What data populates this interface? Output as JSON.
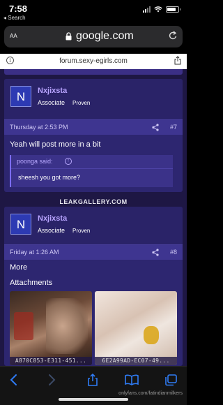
{
  "status_bar": {
    "time": "7:58",
    "back_label": "◂ Search"
  },
  "browser": {
    "text_size_label": "AA",
    "host": "google.com",
    "site_url": "forum.sexy-egirls.com",
    "info_symbol": "i"
  },
  "posts": [
    {
      "avatar_letter": "N",
      "username": "Nxjixsta",
      "user_title": "Associate",
      "user_badge": "Proven",
      "date": "Thursday at 2:53 PM",
      "number": "#7",
      "text": "Yeah will post more in a bit",
      "quote": {
        "author": "poonga said:",
        "arrow": "↑",
        "text": "sheesh you got more?"
      }
    },
    {
      "avatar_letter": "N",
      "username": "Nxjixsta",
      "user_title": "Associate",
      "user_badge": "Proven",
      "date": "Friday at 1:26 AM",
      "number": "#8",
      "text": "More",
      "attachments_label": "Attachments",
      "attachments": [
        {
          "caption": "A870C853-E311-451..."
        },
        {
          "caption": "6E2A99AD-EC07-49..."
        }
      ]
    }
  ],
  "watermarks": {
    "center": "LEAKGALLERY.COM",
    "corner": "onlyfans.com/fatindianmilkers"
  },
  "colors": {
    "page_bg": "#1e1744",
    "post_bg": "#2d2670",
    "meta_bg": "#3e3590",
    "username": "#b8a4ff",
    "avatar": "#2d3ab3",
    "toolbar_icon": "#2f7cf6"
  }
}
